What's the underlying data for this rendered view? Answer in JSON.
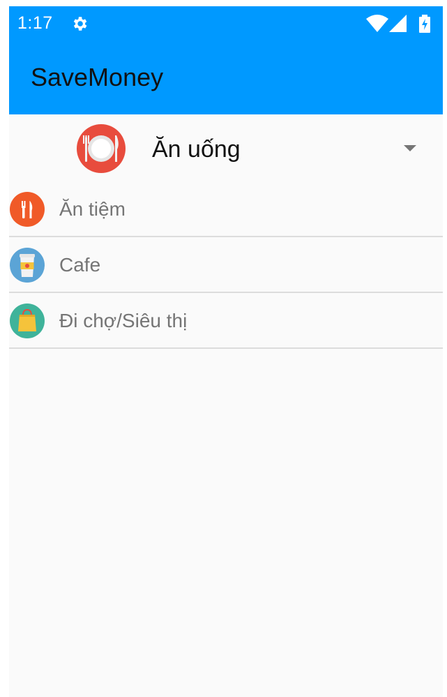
{
  "status_bar": {
    "time": "1:17",
    "settings_icon": "gear-icon",
    "wifi_icon": "wifi-icon",
    "signal_icon": "signal-icon",
    "battery_icon": "battery-charging-icon"
  },
  "app_bar": {
    "title": "SaveMoney",
    "color": "#0099ff"
  },
  "category_spinner": {
    "selected_label": "Ăn uống",
    "icon": "plate-cutlery-icon"
  },
  "subcategories": [
    {
      "label": "Ăn tiệm",
      "icon": "fork-knife-icon",
      "color": "#f05a28"
    },
    {
      "label": "Cafe",
      "icon": "coffee-cup-icon",
      "color": "#5ba4d6"
    },
    {
      "label": "Đi chợ/Siêu thị",
      "icon": "shopping-bag-icon",
      "color": "#3fb39a"
    }
  ]
}
